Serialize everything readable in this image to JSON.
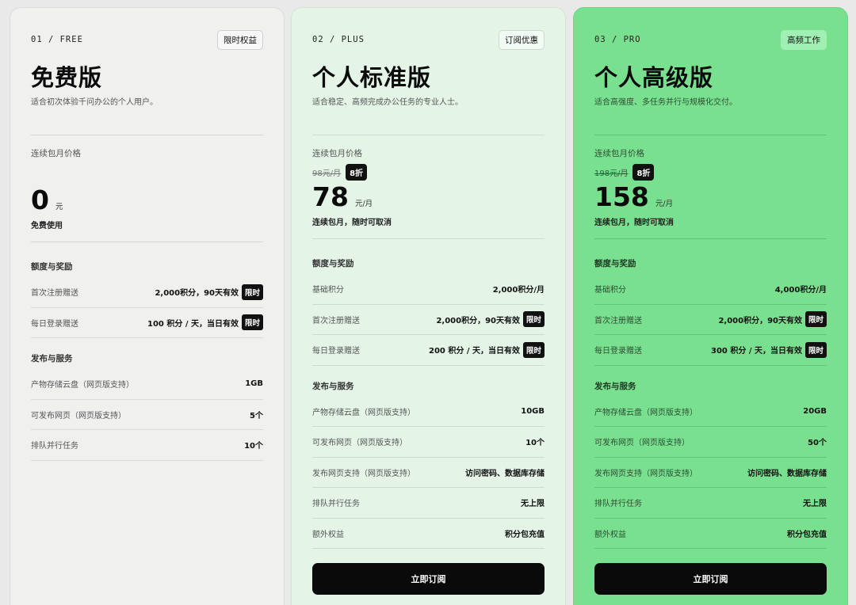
{
  "plans": {
    "free": {
      "code": "01 / FREE",
      "tag": "限时权益",
      "name": "免费版",
      "desc": "适合初次体验千问办公的个人用户。",
      "price_label": "连续包月价格",
      "price": "0",
      "price_unit": "元",
      "price_note": "免费使用",
      "quota_title": "额度与奖励",
      "quota": [
        {
          "label": "首次注册赠送",
          "value": "2,000积分，90天有效",
          "badge": "限时"
        },
        {
          "label": "每日登录赠送",
          "value": "100 积分 / 天，当日有效",
          "badge": "限时"
        }
      ],
      "service_title": "发布与服务",
      "services": [
        {
          "label": "产物存储云盘（网页版支持）",
          "value": "1GB"
        },
        {
          "label": "可发布网页（网页版支持）",
          "value": "5个"
        },
        {
          "label": "排队并行任务",
          "value": "10个"
        }
      ]
    },
    "plus": {
      "code": "02 / PLUS",
      "tag": "订阅优惠",
      "name": "个人标准版",
      "desc": "适合稳定、高频完成办公任务的专业人士。",
      "price_label": "连续包月价格",
      "orig_price": "98元/月",
      "discount": "8折",
      "price": "78",
      "price_unit": "元/月",
      "price_note": "连续包月，随时可取消",
      "quota_title": "额度与奖励",
      "quota": [
        {
          "label": "基础积分",
          "value": "2,000积分/月"
        },
        {
          "label": "首次注册赠送",
          "value": "2,000积分，90天有效",
          "badge": "限时"
        },
        {
          "label": "每日登录赠送",
          "value": "200 积分 / 天，当日有效",
          "badge": "限时"
        }
      ],
      "service_title": "发布与服务",
      "services": [
        {
          "label": "产物存储云盘（网页版支持）",
          "value": "10GB"
        },
        {
          "label": "可发布网页（网页版支持）",
          "value": "10个"
        },
        {
          "label": "发布网页支持（网页版支持）",
          "value": "访问密码、数据库存储"
        },
        {
          "label": "排队并行任务",
          "value": "无上限"
        },
        {
          "label": "额外权益",
          "value": "积分包充值"
        }
      ],
      "button": "立即订阅"
    },
    "pro": {
      "code": "03 / PRO",
      "tag": "高频工作",
      "name": "个人高级版",
      "desc": "适合高强度、多任务并行与规模化交付。",
      "price_label": "连续包月价格",
      "orig_price": "198元/月",
      "discount": "8折",
      "price": "158",
      "price_unit": "元/月",
      "price_note": "连续包月，随时可取消",
      "quota_title": "额度与奖励",
      "quota": [
        {
          "label": "基础积分",
          "value": "4,000积分/月"
        },
        {
          "label": "首次注册赠送",
          "value": "2,000积分，90天有效",
          "badge": "限时"
        },
        {
          "label": "每日登录赠送",
          "value": "300 积分 / 天，当日有效",
          "badge": "限时"
        }
      ],
      "service_title": "发布与服务",
      "services": [
        {
          "label": "产物存储云盘（网页版支持）",
          "value": "20GB"
        },
        {
          "label": "可发布网页（网页版支持）",
          "value": "50个"
        },
        {
          "label": "发布网页支持（网页版支持）",
          "value": "访问密码、数据库存储"
        },
        {
          "label": "排队并行任务",
          "value": "无上限"
        },
        {
          "label": "额外权益",
          "value": "积分包充值"
        }
      ],
      "button": "立即订阅"
    }
  },
  "colors": {
    "free_bg": "#f0f0ef",
    "plus_bg": "#e4f5e8",
    "pro_bg": "#79e08f",
    "button_bg": "#0a0a0a"
  }
}
